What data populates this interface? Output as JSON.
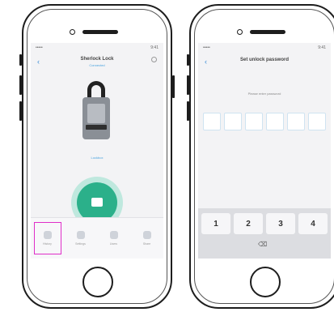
{
  "screen1": {
    "status_left": "•••••",
    "status_right": "9:41",
    "nav": {
      "back": "‹",
      "title": "Sherlock Lock",
      "subtitle": "Connected"
    },
    "lock_caption": "Lockbox",
    "tabs": [
      {
        "label": "History"
      },
      {
        "label": "Settings"
      },
      {
        "label": "Users"
      },
      {
        "label": "Share"
      }
    ],
    "selected_tab_color": "#e02ec8",
    "accent": "#2bb08a"
  },
  "screen2": {
    "status_left": "•••••",
    "status_right": "9:41",
    "title": "Set unlock password",
    "hint": "Please enter password",
    "keys": [
      "1",
      "2",
      "3",
      "4"
    ],
    "delete_label": "⌫"
  }
}
